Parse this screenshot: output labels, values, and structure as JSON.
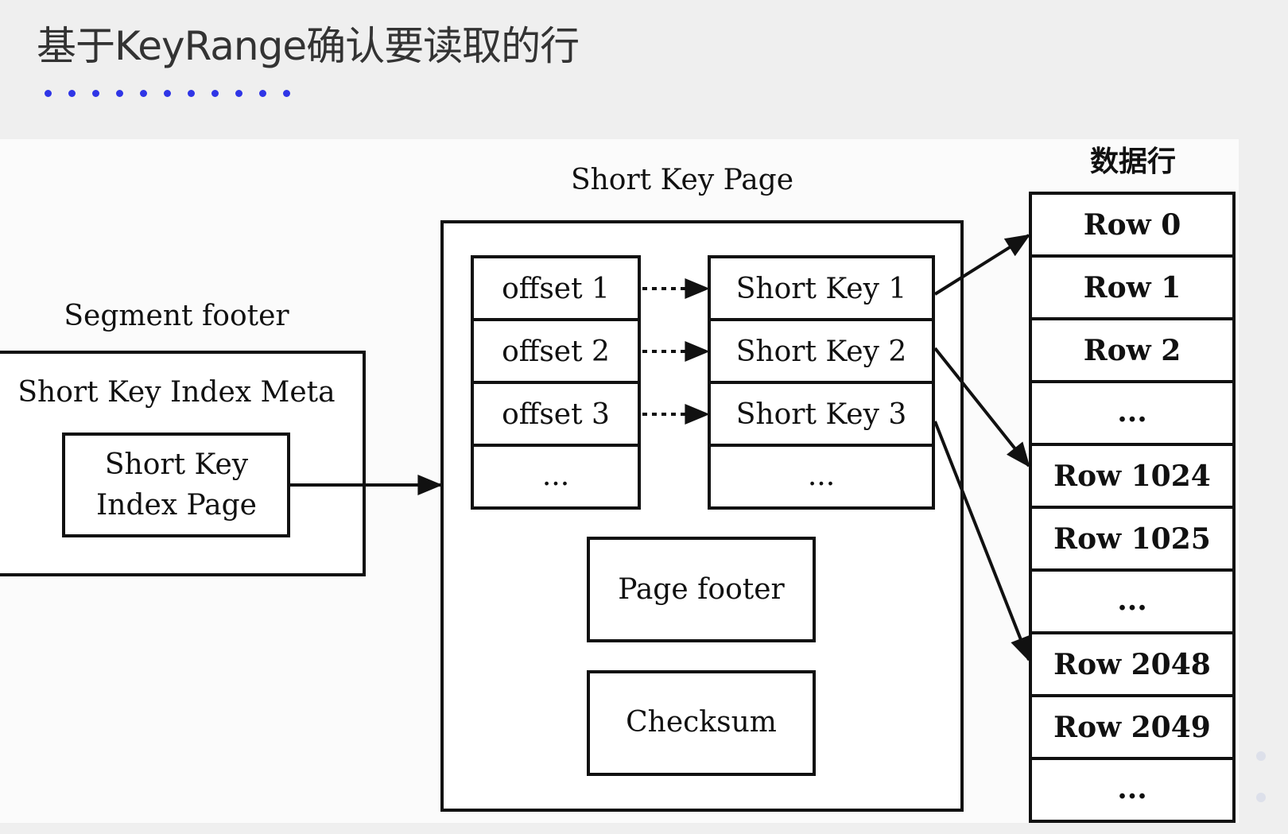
{
  "slide": {
    "title": "基于KeyRange确认要读取的行"
  },
  "diagram": {
    "short_key_page_title": "Short Key Page",
    "data_rows_title": "数据行",
    "segment_footer_title": "Segment footer",
    "index_meta_label": "Short Key Index Meta",
    "index_page_label_line1": "Short Key",
    "index_page_label_line2": "Index Page",
    "offsets": [
      "offset 1",
      "offset 2",
      "offset 3",
      "..."
    ],
    "short_keys": [
      "Short Key 1",
      "Short Key 2",
      "Short Key 3",
      "..."
    ],
    "page_footer_label": "Page footer",
    "checksum_label": "Checksum",
    "rows": [
      "Row 0",
      "Row 1",
      "Row 2",
      "...",
      "Row 1024",
      "Row 1025",
      "...",
      "Row 2048",
      "Row 2049",
      "..."
    ]
  }
}
